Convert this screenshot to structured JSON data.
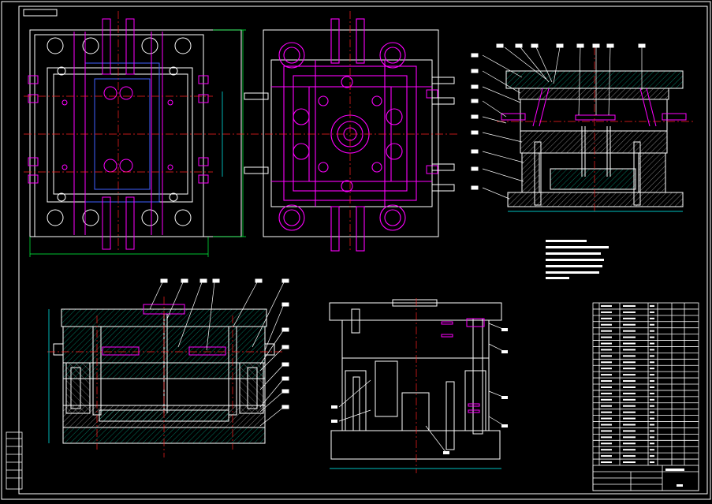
{
  "drawing": {
    "background": "#000000",
    "colors": {
      "line": "#ffffff",
      "center": "#ff2020",
      "magenta": "#ff00ff",
      "green": "#00ff40",
      "cyan": "#00ffff",
      "hatch_green": "#00c8a0",
      "blue": "#4060ff"
    },
    "views": [
      {
        "id": "top-view",
        "label": ""
      },
      {
        "id": "fixed-half-view",
        "label": ""
      },
      {
        "id": "side-section",
        "label": ""
      },
      {
        "id": "main-section",
        "label": ""
      },
      {
        "id": "ejection-section",
        "label": ""
      }
    ],
    "title_block": {
      "label": ""
    },
    "parts_table": {
      "rows": 26
    }
  }
}
